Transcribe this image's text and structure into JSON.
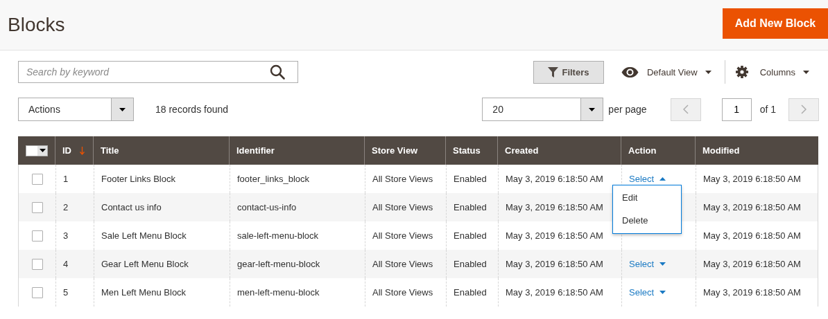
{
  "page": {
    "title": "Blocks",
    "primary_button": "Add New Block"
  },
  "toolbar": {
    "search": {
      "placeholder": "Search by keyword"
    },
    "filters_button": "Filters",
    "view_switcher": "Default View",
    "columns_button": "Columns"
  },
  "mass_actions": {
    "label": "Actions"
  },
  "records_found": "18 records found",
  "pagination": {
    "page_size": "20",
    "per_page_label": "per page",
    "page": "1",
    "of_pages": "of 1"
  },
  "table": {
    "columns": [
      {
        "label": "ID",
        "sorted": true
      },
      {
        "label": "Title",
        "sorted": false
      },
      {
        "label": "Identifier",
        "sorted": false
      },
      {
        "label": "Store View",
        "sorted": false
      },
      {
        "label": "Status",
        "sorted": false
      },
      {
        "label": "Created",
        "sorted": false
      },
      {
        "label": "Action",
        "sorted": false
      },
      {
        "label": "Modified",
        "sorted": false
      }
    ],
    "rows": [
      {
        "selected": false,
        "id": "1",
        "title": "Footer Links Block",
        "identifier": "footer_links_block",
        "store_view": "All Store Views",
        "status": "Enabled",
        "created": "May 3, 2019 6:18:50 AM",
        "action": {
          "label": "Select",
          "expanded": true
        },
        "modified": "May 3, 2019 6:18:50 AM"
      },
      {
        "selected": false,
        "id": "2",
        "title": "Contact us info",
        "identifier": "contact-us-info",
        "store_view": "All Store Views",
        "status": "Enabled",
        "created": "May 3, 2019 6:18:50 AM",
        "modified": "May 3, 2019 6:18:50 AM"
      },
      {
        "selected": false,
        "id": "3",
        "title": "Sale Left Menu Block",
        "identifier": "sale-left-menu-block",
        "store_view": "All Store Views",
        "status": "Enabled",
        "created": "May 3, 2019 6:18:50 AM",
        "modified": "May 3, 2019 6:18:50 AM"
      },
      {
        "selected": false,
        "id": "4",
        "title": "Gear Left Menu Block",
        "identifier": "gear-left-menu-block",
        "store_view": "All Store Views",
        "status": "Enabled",
        "created": "May 3, 2019 6:18:50 AM",
        "action": {
          "label": "Select",
          "expanded": false
        },
        "modified": "May 3, 2019 6:18:50 AM"
      },
      {
        "selected": false,
        "id": "5",
        "title": "Men Left Menu Block",
        "identifier": "men-left-menu-block",
        "store_view": "All Store Views",
        "status": "Enabled",
        "created": "May 3, 2019 6:18:50 AM",
        "action": {
          "label": "Select",
          "expanded": false
        },
        "modified": "May 3, 2019 6:18:50 AM"
      }
    ]
  },
  "mass_select": {
    "checked": false
  },
  "action_menu": {
    "items": [
      "Edit",
      "Delete"
    ]
  }
}
